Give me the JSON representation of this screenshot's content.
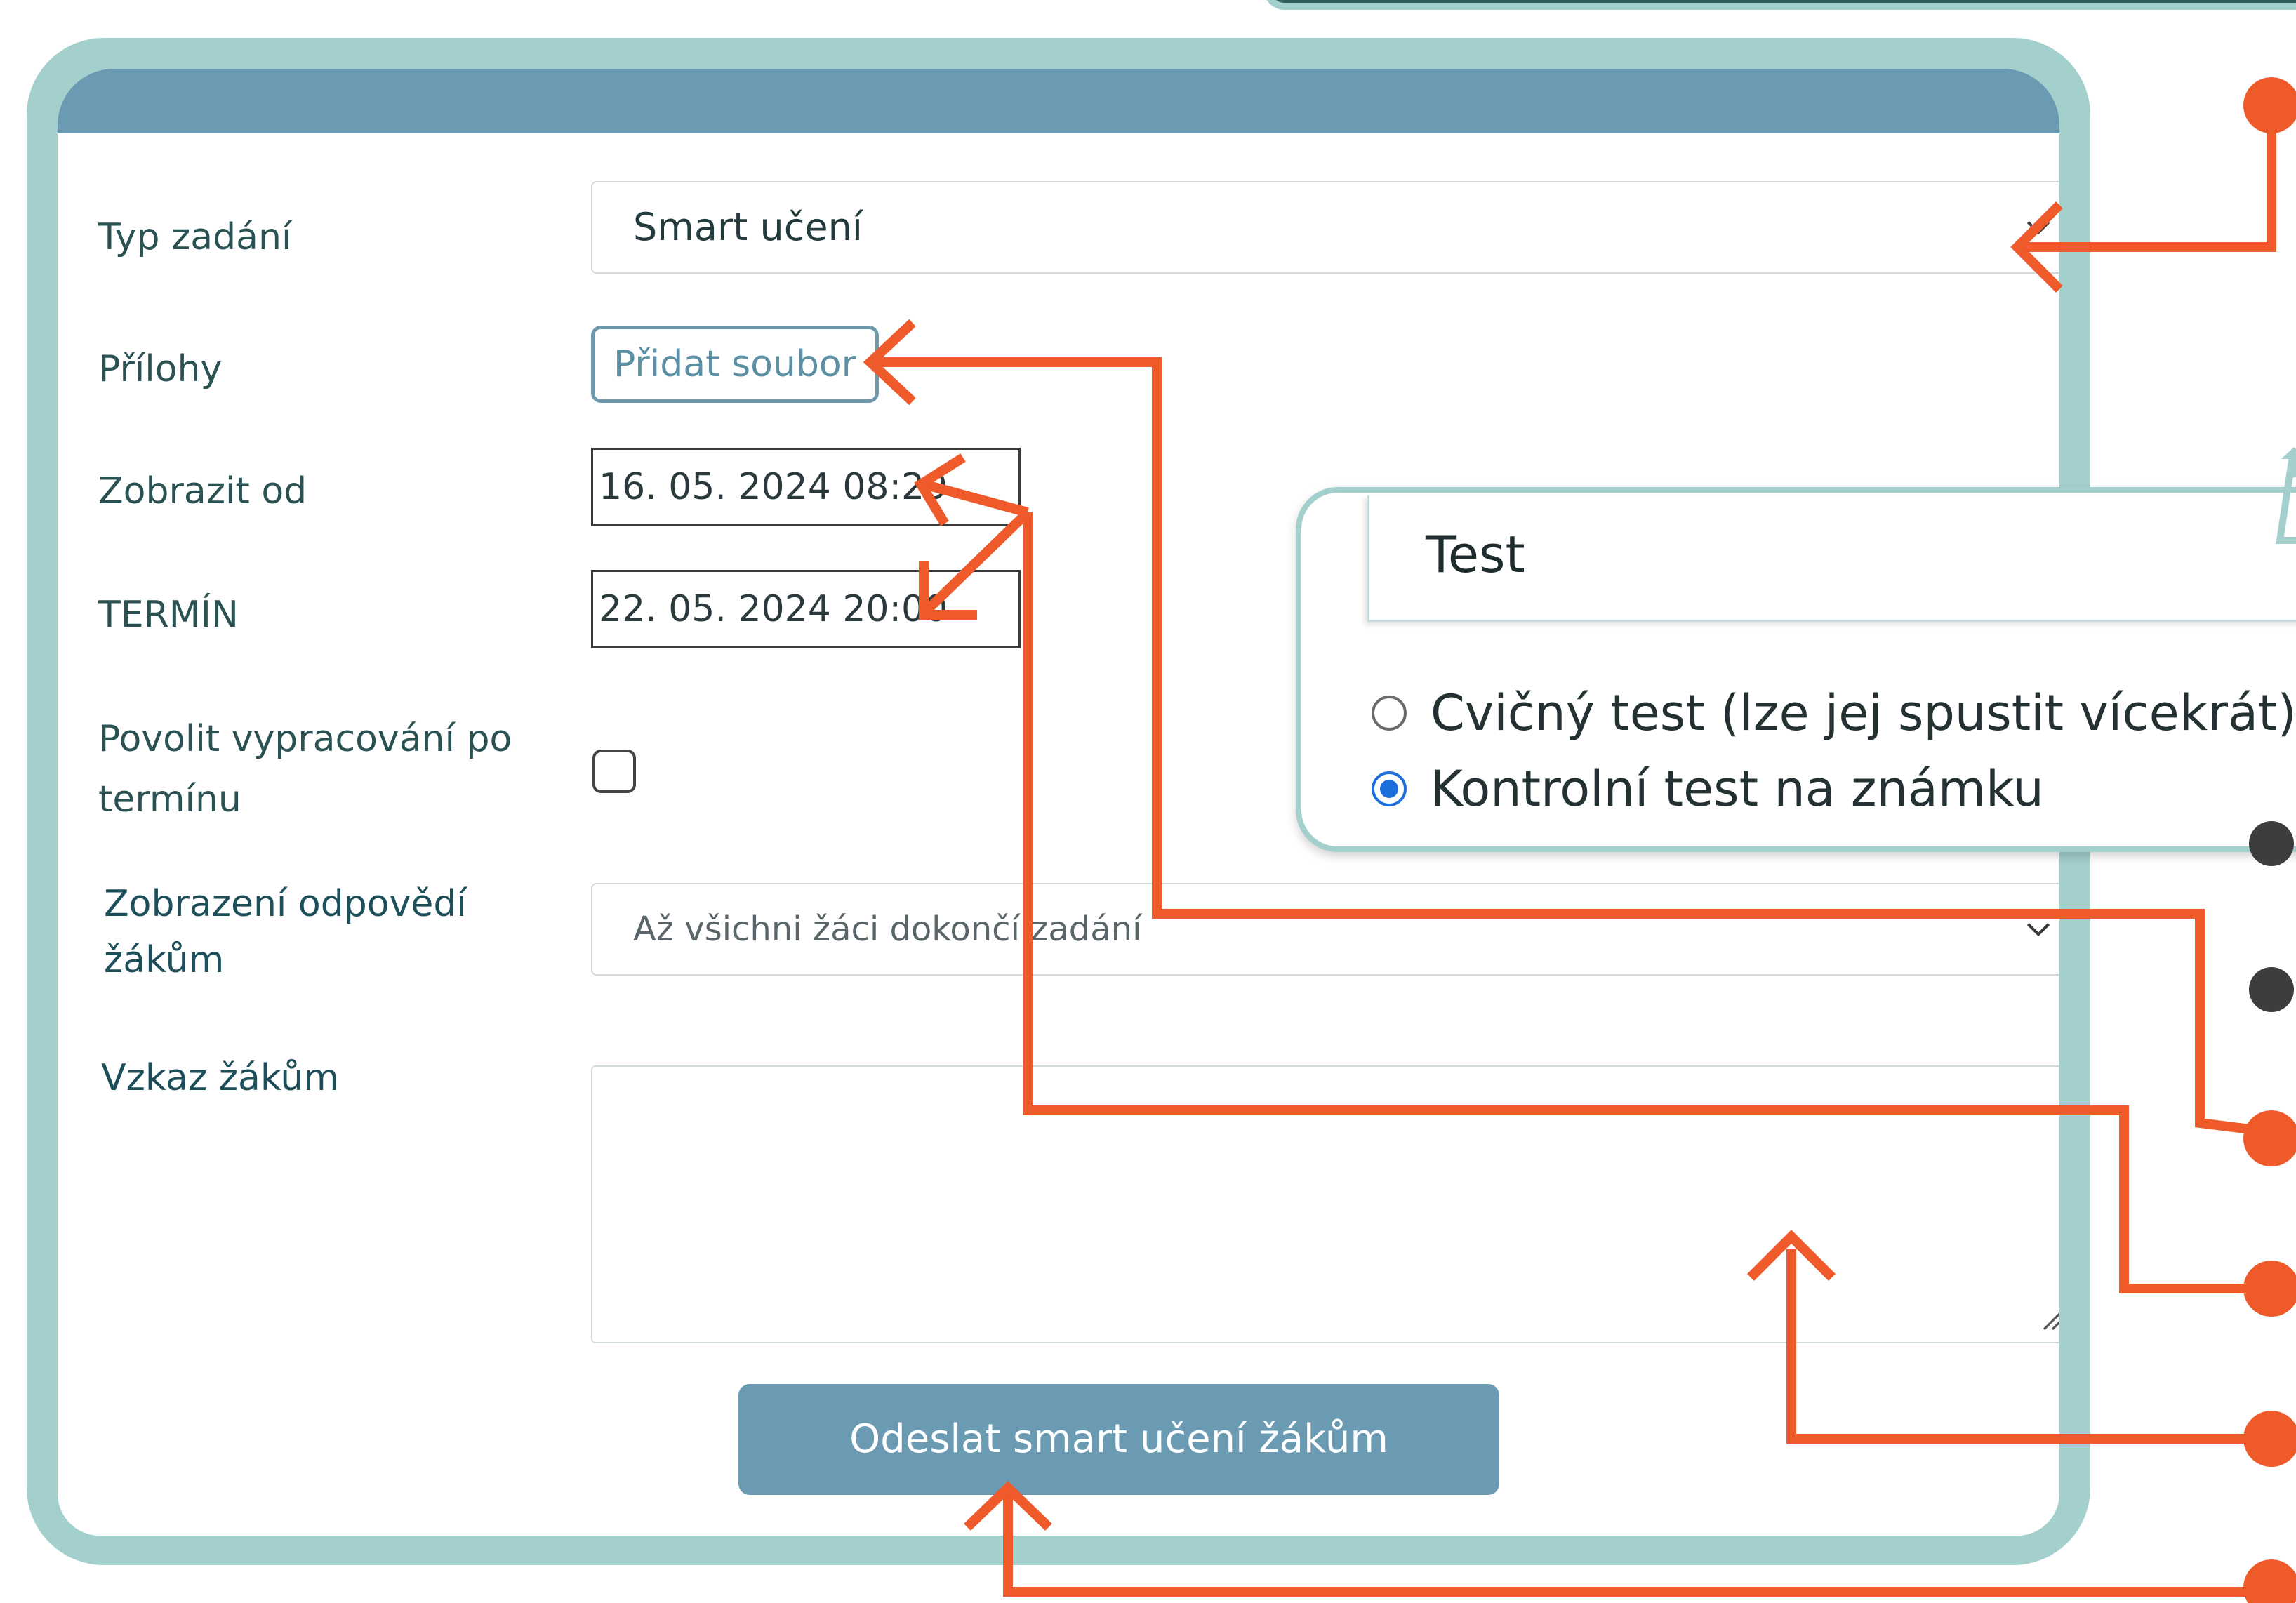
{
  "form": {
    "type_label": "Typ zadání",
    "type_value": "Smart učení",
    "attachments_label": "Přílohy",
    "add_file_label": "Přidat soubor",
    "show_from_label": "Zobrazit od",
    "show_from_value": "16. 05. 2024 08:29",
    "deadline_label": "TERMÍN",
    "deadline_value": "22. 05. 2024 20:00",
    "allow_late_label_line1": "Povolit vypracování po",
    "allow_late_label_line2": "termínu",
    "allow_late_checked": false,
    "answers_label_line1": "Zobrazení odpovědí",
    "answers_label_line2": "žákům",
    "answers_value": "Až všichni žáci dokončí zadání",
    "message_label": "Vzkaz žákům",
    "message_value": "",
    "submit_label": "Odeslat smart učení žákům"
  },
  "popover": {
    "select_value": "Test",
    "options": [
      {
        "label": "Cvičný test (lze jej spustit vícekrát)",
        "checked": false
      },
      {
        "label": "Kontrolní test na známku",
        "checked": true
      }
    ]
  },
  "colors": {
    "frame": "#a3cfcd",
    "header": "#6b9ab3",
    "annotation": "#ee5a2a",
    "bullet_dark": "#3d3d3d",
    "radio_checked": "#1d6fdd"
  },
  "icons": {
    "select_chevron": "chevron-down-icon",
    "textarea_resize": "resize-grip-icon",
    "annotation_bullets": "circle-icon"
  }
}
